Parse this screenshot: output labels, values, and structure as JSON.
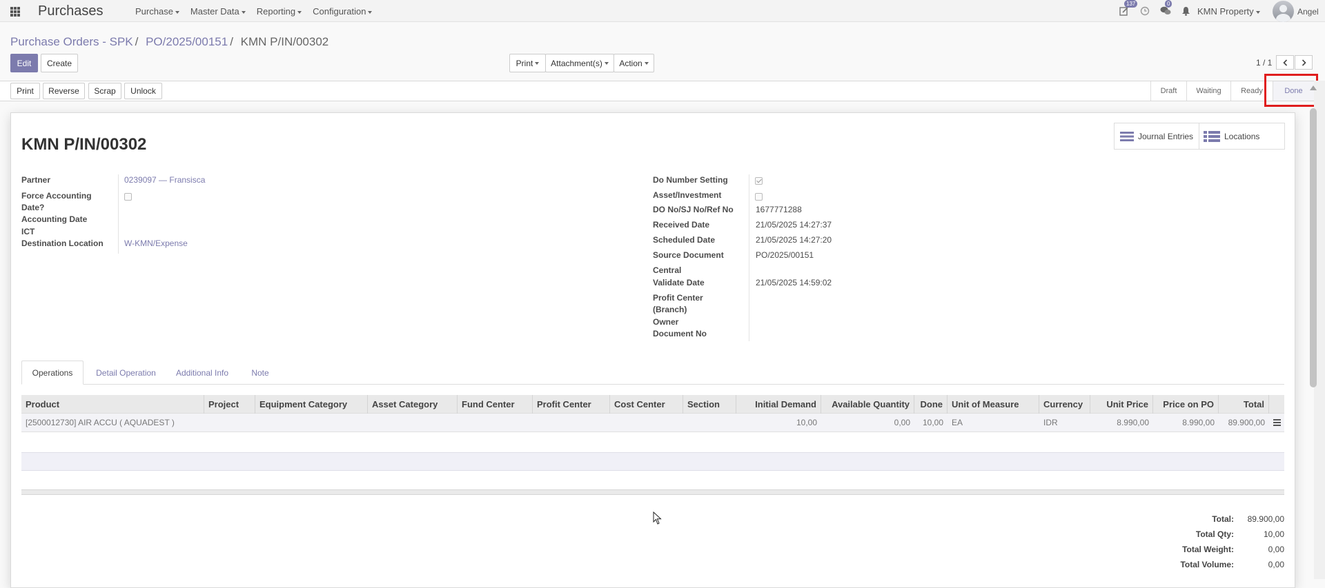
{
  "navbar": {
    "app_title": "Purchases",
    "menu": [
      "Purchase",
      "Master Data",
      "Reporting",
      "Configuration"
    ],
    "activity_badge": "137",
    "messages_badge": "0",
    "company": "KMN Property",
    "user": "Angel"
  },
  "breadcrumb": [
    "Purchase Orders - SPK",
    "PO/2025/00151",
    "KMN P/IN/00302"
  ],
  "control": {
    "edit": "Edit",
    "create": "Create",
    "print": "Print",
    "attachments": "Attachment(s)",
    "action": "Action",
    "pager": "1 / 1"
  },
  "header_buttons": [
    "Print",
    "Reverse",
    "Scrap",
    "Unlock"
  ],
  "status_stages": [
    "Draft",
    "Waiting",
    "Ready",
    "Done"
  ],
  "active_stage": "Done",
  "record": {
    "title": "KMN P/IN/00302",
    "smart_buttons": {
      "journal_entries": "Journal Entries",
      "locations": "Locations"
    },
    "left": {
      "partner_label": "Partner",
      "partner_value": "0239097 — Fransisca",
      "force_label_1": "Force Accounting",
      "force_label_2": "Date?",
      "accounting_date_label": "Accounting Date",
      "ict_label": "ICT",
      "dest_label": "Destination Location",
      "dest_value": "W-KMN/Expense"
    },
    "right": {
      "do_number_setting_label": "Do Number Setting",
      "asset_label": "Asset/Investment",
      "do_no_label": "DO No/SJ No/Ref No",
      "do_no_value": "1677771288",
      "received_label": "Received Date",
      "received_value": "21/05/2025 14:27:37",
      "scheduled_label": "Scheduled Date",
      "scheduled_value": "21/05/2025 14:27:20",
      "source_label": "Source Document",
      "source_value": "PO/2025/00151",
      "central_label": "Central",
      "validate_label": "Validate Date",
      "validate_value": "21/05/2025 14:59:02",
      "profit_label_1": "Profit Center",
      "profit_label_2": "(Branch)",
      "owner_label": "Owner",
      "docno_label": "Document No"
    }
  },
  "tabs": [
    "Operations",
    "Detail Operation",
    "Additional Info",
    "Note"
  ],
  "table": {
    "columns": [
      "Product",
      "Project",
      "Equipment Category",
      "Asset Category",
      "Fund Center",
      "Profit Center",
      "Cost Center",
      "Section",
      "Initial Demand",
      "Available Quantity",
      "Done",
      "Unit of Measure",
      "Currency",
      "Unit Price",
      "Price on PO",
      "Total"
    ],
    "row": [
      "[2500012730] AIR ACCU ( AQUADEST )",
      "",
      "",
      "",
      "",
      "",
      "",
      "",
      "10,00",
      "0,00",
      "10,00",
      "EA",
      "IDR",
      "8.990,00",
      "8.990,00",
      "89.900,00"
    ]
  },
  "totals": {
    "total_label": "Total:",
    "total_value": "89.900,00",
    "qty_label": "Total Qty:",
    "qty_value": "10,00",
    "weight_label": "Total Weight:",
    "weight_value": "0,00",
    "volume_label": "Total Volume:",
    "volume_value": "0,00"
  },
  "colors": {
    "accent": "#7c7bad",
    "highlight": "#e01e1e"
  }
}
